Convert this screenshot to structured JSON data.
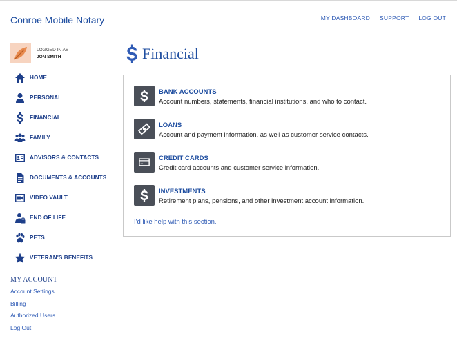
{
  "header": {
    "brand": "Conroe Mobile Notary",
    "nav": [
      "MY DASHBOARD",
      "SUPPORT",
      "LOG OUT"
    ]
  },
  "user": {
    "label": "LOGGED IN AS",
    "name": "JON SMITH"
  },
  "sidebar": {
    "items": [
      {
        "label": "HOME",
        "icon": "home-icon"
      },
      {
        "label": "PERSONAL",
        "icon": "person-icon"
      },
      {
        "label": "FINANCIAL",
        "icon": "dollar-icon"
      },
      {
        "label": "FAMILY",
        "icon": "family-icon"
      },
      {
        "label": "ADVISORS & CONTACTS",
        "icon": "contact-card-icon"
      },
      {
        "label": "DOCUMENTS & ACCOUNTS",
        "icon": "document-icon"
      },
      {
        "label": "VIDEO VAULT",
        "icon": "video-camera-icon"
      },
      {
        "label": "END OF LIFE",
        "icon": "person-lock-icon"
      },
      {
        "label": "PETS",
        "icon": "paw-icon"
      },
      {
        "label": "VETERAN'S BENEFITS",
        "icon": "star-icon"
      }
    ]
  },
  "account": {
    "title": "MY ACCOUNT",
    "links": [
      "Account Settings",
      "Billing",
      "Authorized Users",
      "Log Out"
    ]
  },
  "page": {
    "title": "Financial",
    "icon": "dollar-icon"
  },
  "sections": [
    {
      "title": "BANK ACCOUNTS",
      "desc": "Account numbers, statements, financial institutions, and who to contact.",
      "icon": "dollar-icon"
    },
    {
      "title": "LOANS",
      "desc": "Account and payment information, as well as customer service contacts.",
      "icon": "money-bill-icon"
    },
    {
      "title": "CREDIT CARDS",
      "desc": "Credit card accounts and customer service information.",
      "icon": "credit-card-icon"
    },
    {
      "title": "INVESTMENTS",
      "desc": "Retirement plans, pensions, and other investment account information.",
      "icon": "dollar-icon"
    }
  ],
  "help_link": "I'd like help with this section.",
  "colors": {
    "accent": "#1f4ea0",
    "nav": "#1e3f8a",
    "link": "#2f5bb5",
    "icon_box": "#4a4f58"
  }
}
